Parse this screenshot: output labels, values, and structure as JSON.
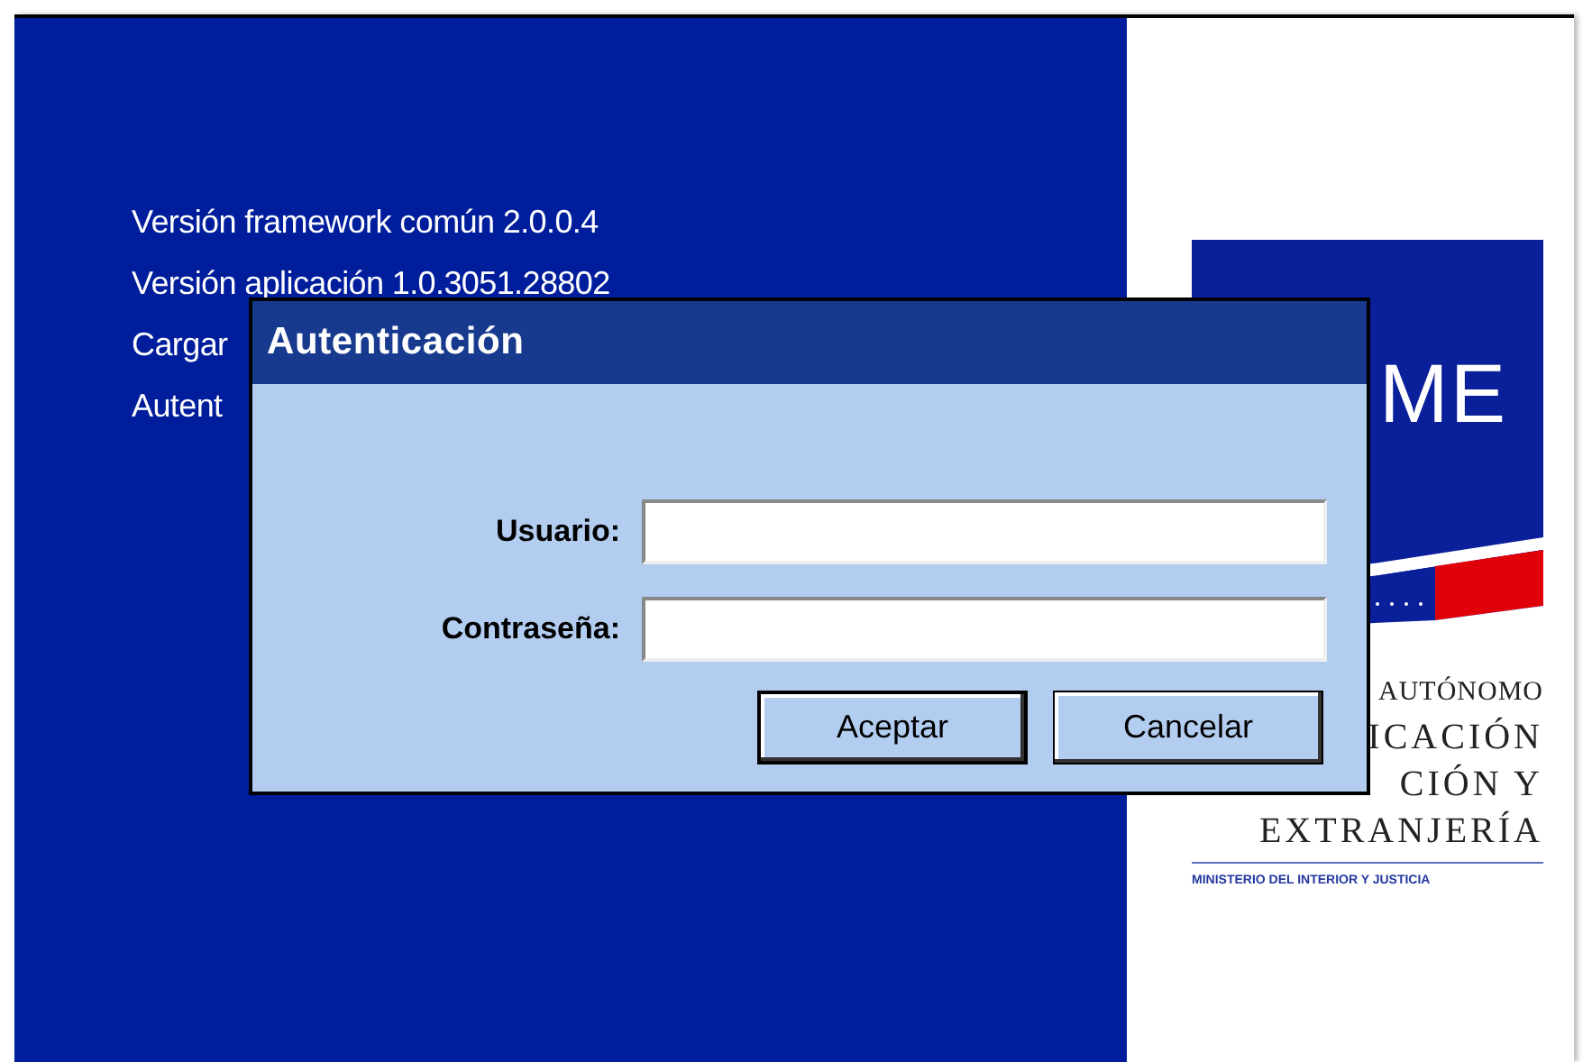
{
  "splash": {
    "lines": [
      "Versión framework común 2.0.0.4",
      "Versión aplicación 1.0.3051.28802",
      "Cargar",
      "Autent"
    ],
    "logo": {
      "mark": "ME",
      "lines": [
        {
          "kind": "small",
          "text": "AUTÓNOMO"
        },
        {
          "kind": "large",
          "text": "ICACIÓN"
        },
        {
          "kind": "large",
          "text": "CIÓN Y"
        },
        {
          "kind": "large",
          "text": "EXTRANJERÍA"
        }
      ],
      "ministry": "MINISTERIO DEL INTERIOR Y JUSTICIA"
    }
  },
  "dialog": {
    "title": "Autenticación",
    "fields": [
      {
        "label": "Usuario:"
      },
      {
        "label": "Contraseña:"
      }
    ],
    "buttons": [
      {
        "label": "Aceptar",
        "default": true
      },
      {
        "label": "Cancelar",
        "default": false
      }
    ]
  }
}
